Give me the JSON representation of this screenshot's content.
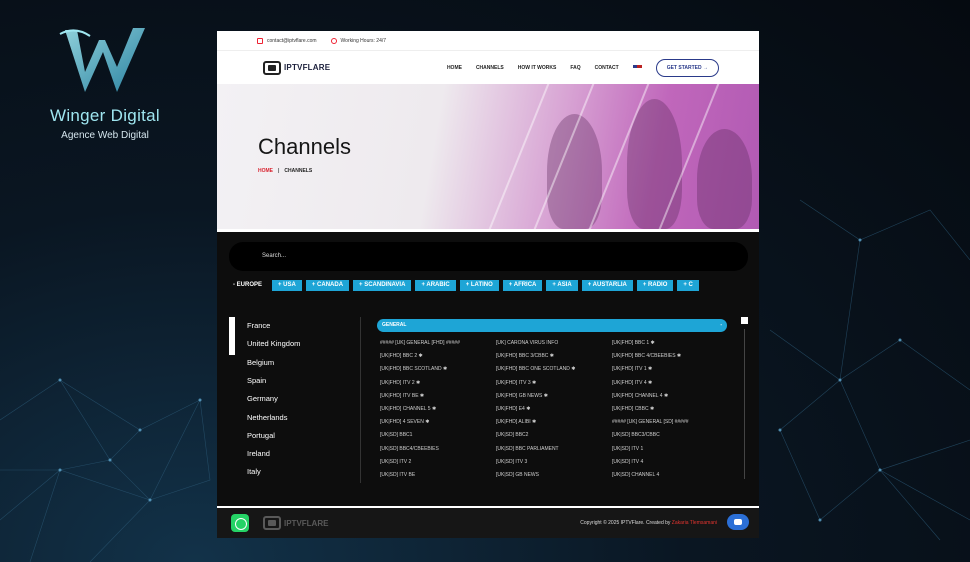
{
  "brand": {
    "logo_icon": "w-letter-logo-icon",
    "name": "Winger Digital",
    "tagline": "Agence Web Digital",
    "accent": "#9fe6f0"
  },
  "topbar": {
    "email": "contact@iptvflare.com",
    "hours": "Working Hours: 24/7"
  },
  "header": {
    "logo_text": "IPTVFLARE",
    "nav": [
      "HOME",
      "CHANNELS",
      "HOW IT WORKS",
      "FAQ",
      "CONTACT"
    ],
    "language": "en-us-flag-icon",
    "cta": "GET STARTED",
    "cta_arrow": "→"
  },
  "hero": {
    "title": "Channels",
    "breadcrumb_home": "HOME",
    "breadcrumb_sep": "|",
    "breadcrumb_current": "CHANNELS"
  },
  "search": {
    "placeholder": "Search..."
  },
  "regions": [
    "- EUROPE",
    "+ USA",
    "+ CANADA",
    "+ SCANDINAVIA",
    "+ ARABIC",
    "+ LATINO",
    "+ AFRICA",
    "+ ASIA",
    "+ AUSTARLIA",
    "+ RADIO",
    "+ C"
  ],
  "countries": [
    "France",
    "United Kingdom",
    "Belgium",
    "Spain",
    "Germany",
    "Netherlands",
    "Portugal",
    "Ireland",
    "Italy"
  ],
  "group": {
    "label": "GENERAL",
    "toggle": "-"
  },
  "channels": [
    "##### [UK] GENERAL [FHD] #####",
    "[UK] CARONA VIRUS INFO",
    "[UK|FHD] BBC 1 ✱",
    "[UK|FHD] BBC 2 ✱",
    "[UK|FHD] BBC 3/CBBC ✱",
    "[UK|FHD] BBC 4/CBEEBIES ✱",
    "[UK|FHD] BBC SCOTLAND ✱",
    "[UK|FHD] BBC ONE SCOTLAND ✱",
    "[UK|FHD] ITV 1 ✱",
    "[UK|FHD] ITV 2 ✱",
    "[UK|FHD] ITV 3 ✱",
    "[UK|FHD] ITV 4 ✱",
    "[UK|FHD] ITV BE ✱",
    "[UK|FHD] GB NEWS ✱",
    "[UK|FHD] CHANNEL 4 ✱",
    "[UK|FHD] CHANNEL 5 ✱",
    "[UK|FHD] E4 ✱",
    "[UK|FHD] CBBC ✱",
    "[UK|FHD] 4 SEVEN ✱",
    "[UK|FHD] ALIBI ✱",
    "##### [UK] GENERAL [SD] #####",
    "[UK|SD] BBC1",
    "[UK|SD] BBC2",
    "[UK|SD] BBC3/CBBC",
    "[UK|SD] BBC4/CBEEBIES",
    "[UK|SD] BBC PARLIAMENT",
    "[UK|SD] ITV 1",
    "[UK|SD] ITV 2",
    "[UK|SD] ITV 3",
    "[UK|SD] ITV 4",
    "[UK|SD] ITV BE",
    "[UK|SD] GB NEWS",
    "[UK|SD] CHANNEL 4"
  ],
  "footer": {
    "logo_text": "IPTVFLARE",
    "copyright": "Copyright © 2025 IPTVFlare. Created by",
    "author": "Zakaria Tlemsamani"
  },
  "colors": {
    "accent": "#1ea5d6",
    "brand_red": "#d9232f",
    "nav_blue": "#2a3a8a"
  }
}
